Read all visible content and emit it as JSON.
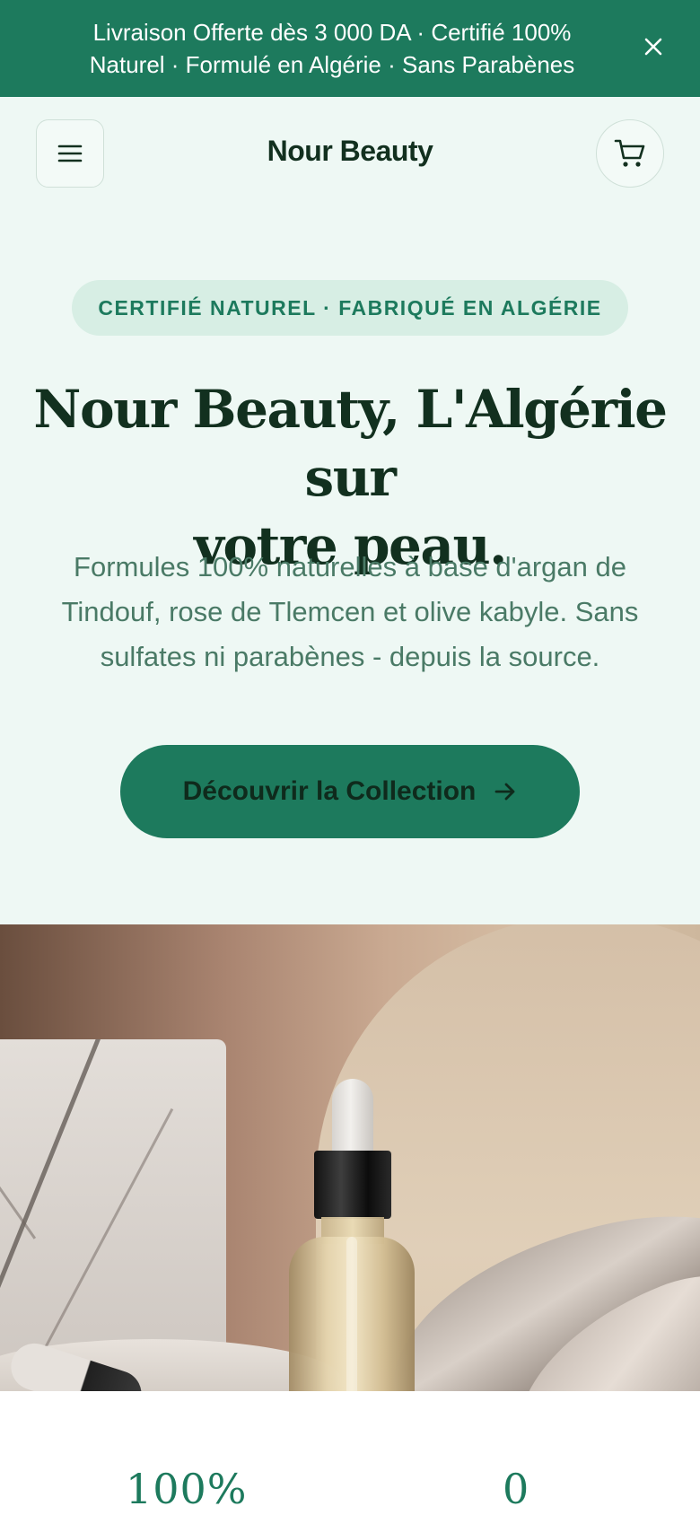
{
  "announcement": {
    "line1": "Livraison Offerte dès 3 000 DA · Certifié 100%",
    "line2": "Naturel · Formulé en Algérie · Sans Parabènes",
    "close_icon": "close-icon"
  },
  "header": {
    "brand": "Nour Beauty",
    "menu_icon": "hamburger-menu-icon",
    "cart_icon": "shopping-cart-icon"
  },
  "hero": {
    "badge": "CERTIFIÉ NATUREL · FABRIQUÉ EN ALGÉRIE",
    "title_line1": "Nour Beauty, L'Algérie sur",
    "title_line2": "votre peau.",
    "subtitle_line1": "Formules 100% naturelles à base d'argan de",
    "subtitle_line2": "Tindouf, rose de Tlemcen et olive kabyle. Sans",
    "subtitle_line3": "sulfates ni parabènes - depuis la source.",
    "cta_label": "Découvrir la Collection",
    "cta_icon": "arrow-right-icon"
  },
  "stats": {
    "stat1": "100%",
    "stat2": "0"
  },
  "colors": {
    "primary": "#1d7a5d",
    "background": "#eef8f4",
    "badge_bg": "#d7eee4",
    "text_dark": "#12301f",
    "text_muted": "#4a7a66"
  }
}
